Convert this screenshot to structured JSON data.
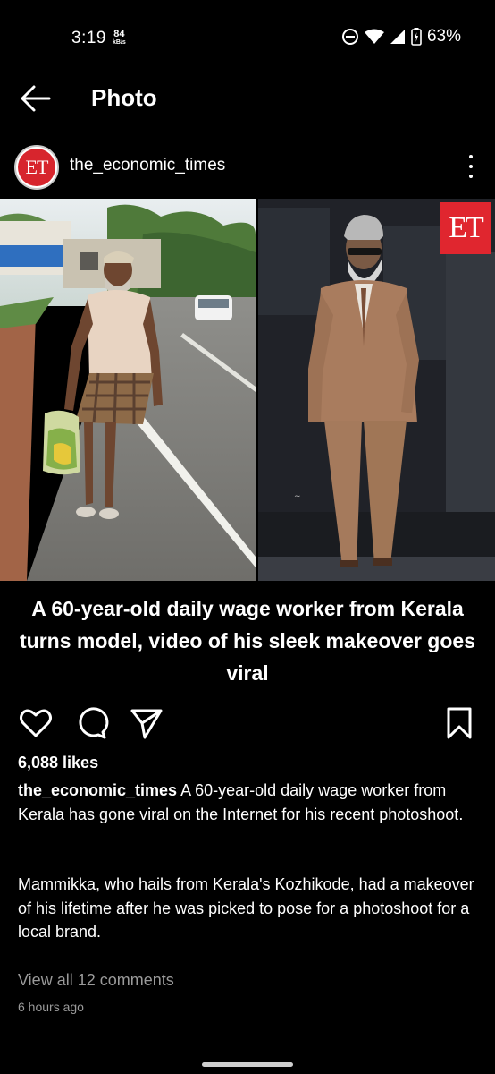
{
  "status_bar": {
    "time": "3:19",
    "net_speed_value": "84",
    "net_speed_unit": "kB/s",
    "battery": "63%",
    "icons": [
      "do-not-disturb-icon",
      "wifi-icon",
      "cell-signal-icon",
      "battery-icon"
    ]
  },
  "app_bar": {
    "title": "Photo",
    "back_icon": "arrow-left-icon"
  },
  "post": {
    "username": "the_economic_times",
    "avatar_text": "ET",
    "more_icon": "more-vertical-icon",
    "image": {
      "badge_text": "ET",
      "headline": "A 60-year-old daily wage worker from Kerala turns model, video of his sleek makeover goes viral"
    },
    "actions": {
      "like_icon": "heart-icon",
      "comment_icon": "comment-icon",
      "share_icon": "send-icon",
      "save_icon": "bookmark-icon"
    },
    "likes": "6,088 likes",
    "caption_user": "the_economic_times",
    "caption_text": " A 60-year-old daily wage worker from Kerala has gone viral on the Internet for his recent photoshoot.",
    "caption_paragraph_2": "Mammikka, who hails from Kerala's Kozhikode, had a makeover of his lifetime after he was picked to pose for a photoshoot for a local brand.",
    "view_comments": "View all 12 comments",
    "timestamp": "6 hours ago"
  },
  "colors": {
    "background": "#000000",
    "text": "#ffffff",
    "muted": "#9a9a9a",
    "et_red": "#e0262f"
  }
}
